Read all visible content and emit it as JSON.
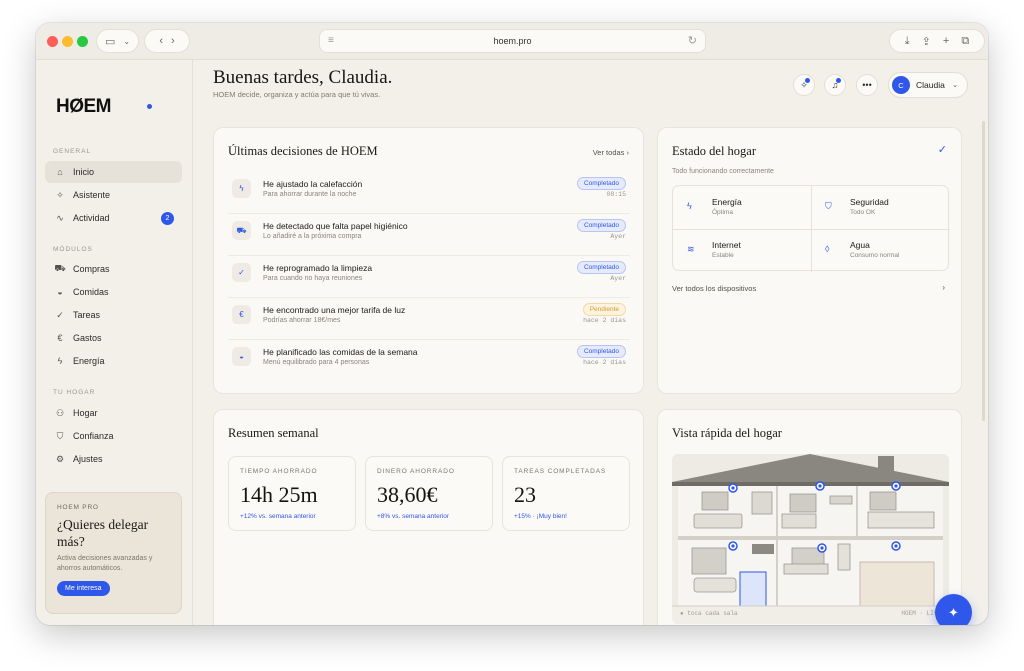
{
  "browser": {
    "url": "hoem.pro"
  },
  "sidebar": {
    "logo": "HØEM",
    "sections": {
      "general": "GENERAL",
      "modules": "MÓDULOS",
      "home": "TU HOGAR"
    },
    "items": [
      {
        "label": "Inicio",
        "icon": "home-icon"
      },
      {
        "label": "Asistente",
        "icon": "sparkle-icon"
      },
      {
        "label": "Actividad",
        "icon": "activity-icon",
        "badge": "2"
      },
      {
        "label": "Compras",
        "icon": "cart-icon"
      },
      {
        "label": "Comidas",
        "icon": "bowl-icon"
      },
      {
        "label": "Tareas",
        "icon": "check-icon"
      },
      {
        "label": "Gastos",
        "icon": "euro-icon"
      },
      {
        "label": "Energía",
        "icon": "bolt-icon"
      },
      {
        "label": "Hogar",
        "icon": "people-icon"
      },
      {
        "label": "Confianza",
        "icon": "shield-icon"
      },
      {
        "label": "Ajustes",
        "icon": "gear-icon"
      }
    ],
    "promo": {
      "label": "HOEM PRO",
      "title": "¿Quieres delegar más?",
      "description": "Activa decisiones avanzadas y ahorros automáticos.",
      "button": "Me interesa"
    }
  },
  "header": {
    "greeting": "Buenas tardes, Claudia.",
    "subtitle": "HOEM decide, organiza y actúa para que tú vivas.",
    "user": {
      "initial": "C",
      "name": "Claudia"
    }
  },
  "decisions": {
    "title": "Últimas decisiones de HOEM",
    "see_all": "Ver todas ›",
    "items": [
      {
        "title": "He ajustado la calefacción",
        "subtitle": "Para ahorrar durante la noche",
        "status": "Completado",
        "time": "08:15",
        "icon": "bolt-icon"
      },
      {
        "title": "He detectado que falta papel higiénico",
        "subtitle": "Lo añadiré a la próxima compra",
        "status": "Completado",
        "time": "Ayer",
        "icon": "cart-icon"
      },
      {
        "title": "He reprogramado la limpieza",
        "subtitle": "Para cuando no haya reuniones",
        "status": "Completado",
        "time": "Ayer",
        "icon": "check-icon"
      },
      {
        "title": "He encontrado una mejor tarifa de luz",
        "subtitle": "Podrías ahorrar 18€/mes",
        "status": "Pendiente",
        "time": "hace 2 días",
        "icon": "euro-icon"
      },
      {
        "title": "He planificado las comidas de la semana",
        "subtitle": "Menú equilibrado para 4 personas",
        "status": "Completado",
        "time": "hace 2 días",
        "icon": "bowl-icon"
      }
    ]
  },
  "home_status": {
    "title": "Estado del hogar",
    "subtitle": "Todo funcionando correctamente",
    "cells": [
      {
        "title": "Energía",
        "subtitle": "Óptima",
        "icon": "bolt-icon"
      },
      {
        "title": "Seguridad",
        "subtitle": "Todo OK",
        "icon": "shield-icon"
      },
      {
        "title": "Internet",
        "subtitle": "Estable",
        "icon": "wifi-icon"
      },
      {
        "title": "Agua",
        "subtitle": "Consumo normal",
        "icon": "drop-icon"
      }
    ],
    "devices_link": "Ver todos los dispositivos"
  },
  "weekly": {
    "title": "Resumen semanal",
    "stats": [
      {
        "label": "TIEMPO AHORRADO",
        "value": "14h 25m",
        "delta": "+12% vs. semana anterior"
      },
      {
        "label": "DINERO AHORRADO",
        "value": "38,60€",
        "delta": "+8% vs. semana anterior"
      },
      {
        "label": "TAREAS COMPLETADAS",
        "value": "23",
        "delta": "+15% · ¡Muy bien!"
      }
    ]
  },
  "quick_view": {
    "title": "Vista rápida del hogar",
    "footer_left": "● toca cada sala",
    "footer_right": "HOEM · LIVE"
  },
  "colors": {
    "accent": "#2f57e9",
    "background": "#f3f0ea",
    "card": "#fbf9f5",
    "pending": "#d39b35"
  }
}
